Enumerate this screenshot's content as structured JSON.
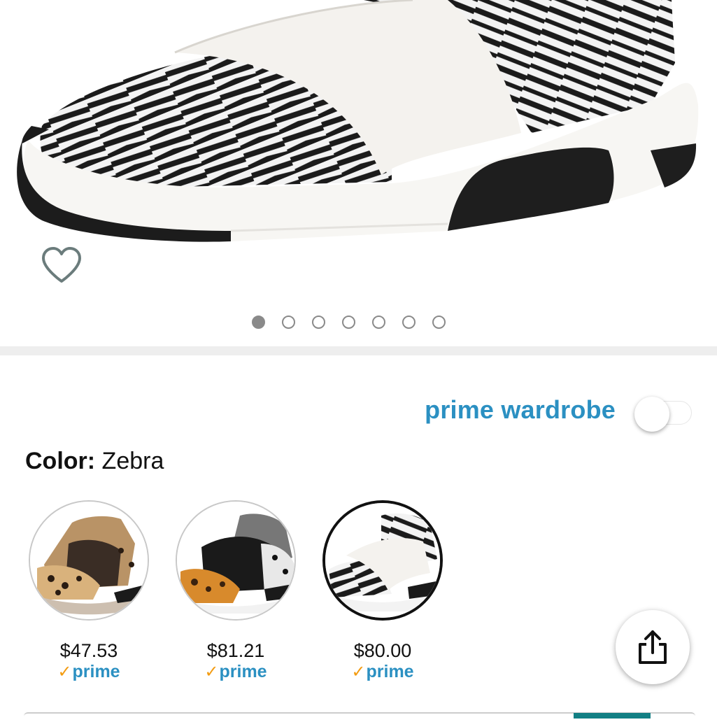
{
  "product_image": {
    "alt": "Zebra knit slip-on sneaker"
  },
  "carousel": {
    "total": 7,
    "active_index": 0
  },
  "wishlist": {
    "icon": "heart-outline-icon"
  },
  "prime_wardrobe": {
    "label": "prime wardrobe",
    "enabled": false
  },
  "color": {
    "label": "Color:",
    "value": "Zebra"
  },
  "swatches": [
    {
      "name": "Leopard",
      "price": "$47.53",
      "prime": "prime",
      "selected": false
    },
    {
      "name": "Cheetah",
      "price": "$81.21",
      "prime": "prime",
      "selected": false
    },
    {
      "name": "Zebra",
      "price": "$80.00",
      "prime": "prime",
      "selected": true
    }
  ],
  "share": {
    "icon": "share-icon"
  },
  "colors": {
    "prime_blue": "#2b90c2",
    "prime_check": "#f39c12",
    "accent_teal": "#127f84"
  }
}
